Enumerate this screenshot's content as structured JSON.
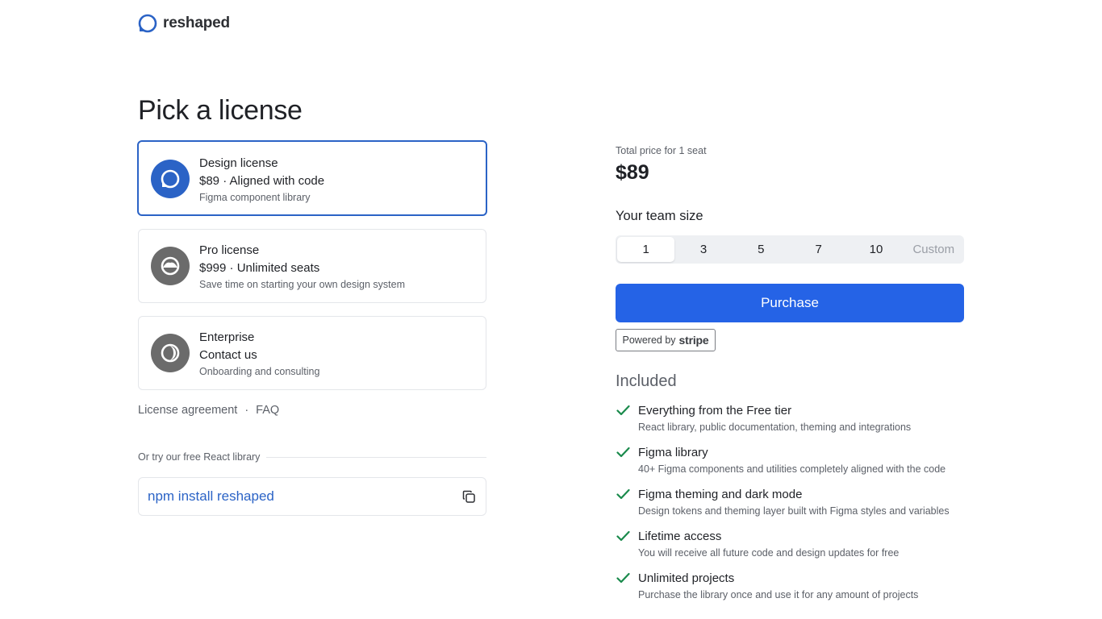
{
  "brand": {
    "name": "reshaped",
    "accent": "#2b63c6"
  },
  "page": {
    "title": "Pick a license"
  },
  "licenses": [
    {
      "name": "Design license",
      "price": "$89 · Aligned with code",
      "description": "Figma component library",
      "icon": "design-license-icon",
      "icon_color": "#2b63c6",
      "selected": true
    },
    {
      "name": "Pro license",
      "price": "$999 · Unlimited seats",
      "description": "Save time on starting your own design system",
      "icon": "pro-license-icon",
      "icon_color": "#6b6b6b",
      "selected": false
    },
    {
      "name": "Enterprise",
      "price": "Contact us",
      "description": "Onboarding and consulting",
      "icon": "enterprise-icon",
      "icon_color": "#6b6b6b",
      "selected": false
    }
  ],
  "links": {
    "agreement": "License agreement",
    "separator": "·",
    "faq": "FAQ"
  },
  "free_library": {
    "label": "Or try our free React library",
    "command": "npm install reshaped",
    "copy_icon": "copy-icon"
  },
  "pricing": {
    "total_label": "Total price for 1 seat",
    "total_price": "$89",
    "team_size_label": "Your team size",
    "team_sizes": [
      "1",
      "3",
      "5",
      "7",
      "10",
      "Custom"
    ],
    "selected_team_size": "1",
    "purchase_label": "Purchase",
    "purchase_color": "#2563e6",
    "powered_by": "Powered by",
    "powered_brand": "stripe"
  },
  "included": {
    "title": "Included",
    "items": [
      {
        "title": "Everything from the Free tier",
        "description": "React library, public documentation, theming and integrations"
      },
      {
        "title": "Figma library",
        "description": "40+ Figma components and utilities completely aligned with the code"
      },
      {
        "title": "Figma theming and dark mode",
        "description": "Design tokens and theming layer built with Figma styles and variables"
      },
      {
        "title": "Lifetime access",
        "description": "You will receive all future code and design updates for free"
      },
      {
        "title": "Unlimited projects",
        "description": "Purchase the library once and use it for any amount of projects"
      }
    ],
    "check_color": "#1a8a4c"
  }
}
